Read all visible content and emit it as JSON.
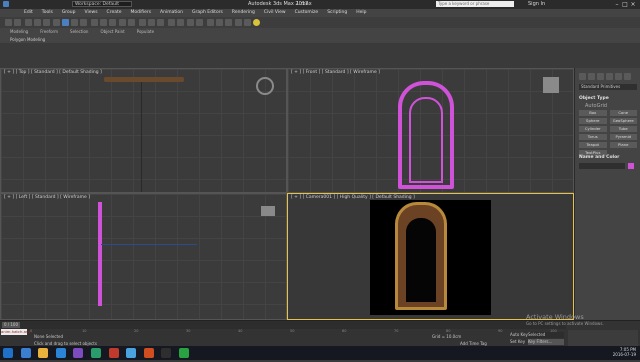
{
  "titlebar": {
    "workspace": "Workspace: Default",
    "app_title": "Autodesk 3ds Max 2017",
    "file": "1.max",
    "search_placeholder": "Type a keyword or phrase",
    "sign_in": "Sign In"
  },
  "menu": [
    "Edit",
    "Tools",
    "Group",
    "Views",
    "Create",
    "Modifiers",
    "Animation",
    "Graph Editors",
    "Rendering",
    "Civil View",
    "Customize",
    "Scripting",
    "Help"
  ],
  "ribbon": {
    "tabs": [
      "Modeling",
      "Freeform",
      "Selection",
      "Object Paint",
      "Populate"
    ],
    "poly_label": "Polygon Modeling"
  },
  "viewports": {
    "top": "[ + ] [ Top ] [ Standard ] [ Default Shading ]",
    "front": "[ + ] [ Front ] [ Standard ] [ Wireframe ]",
    "left": "[ + ] [ Left ] [ Standard ] [ Wireframe ]",
    "camera": "[ + ] [ Camera001 ] [ High Quality ] [ Default Shading ]"
  },
  "command_panel": {
    "dropdown": "Standard Primitives",
    "object_type": "Object Type",
    "autogrid": "AutoGrid",
    "buttons": [
      "Box",
      "Cone",
      "Sphere",
      "GeoSphere",
      "Cylinder",
      "Tube",
      "Torus",
      "Pyramid",
      "Teapot",
      "Plane",
      "TextPlus"
    ],
    "name_color": "Name and Color"
  },
  "status": {
    "frame": "0 / 100",
    "selection": "None Selected",
    "hint": "Click and drag to select objects",
    "maxscript": "anim.hatch.aris",
    "add_time_tag": "Add Time Tag",
    "auto_key": "Auto Key",
    "set_key": "Set Key",
    "selected": "Selected",
    "key_filters": "Key Filters...",
    "grid": "Grid = 10.0cm",
    "time": "7:05 PM",
    "date": "2016-07-19"
  },
  "timeline_ticks": [
    "0",
    "10",
    "20",
    "30",
    "40",
    "50",
    "60",
    "70",
    "80",
    "90",
    "100"
  ],
  "watermark": {
    "line1": "Activate Windows",
    "line2": "Go to PC settings to activate Windows."
  },
  "colors": {
    "selection": "#cf52d8",
    "active_viewport": "#e6c24a",
    "accent": "#4a7fc0"
  }
}
